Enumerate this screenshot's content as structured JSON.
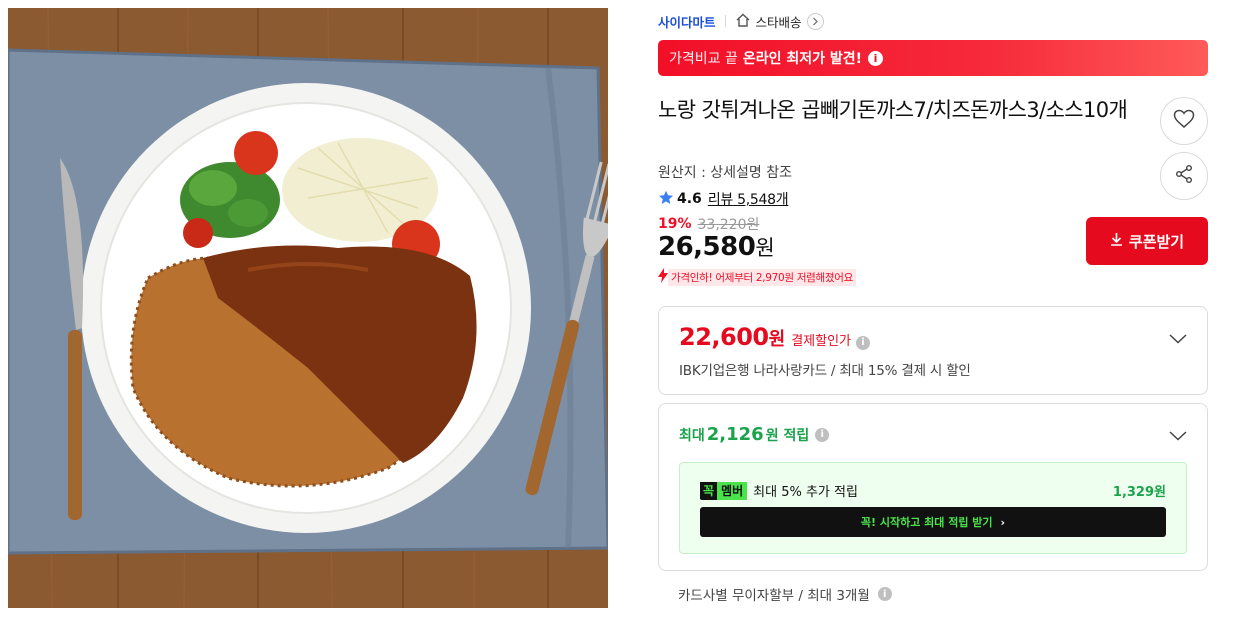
{
  "store": {
    "name": "사이다마트",
    "shipping_label": "스타배송"
  },
  "banner": {
    "prefix": "가격비교 끝",
    "highlight": "온라인 최저가 발견!",
    "info_icon": "info-icon"
  },
  "product": {
    "title": "노랑 갓튀겨나온 곱빼기돈까스7/치즈돈까스3/소스10개",
    "origin": "원산지 : 상세설명 참조",
    "rating": "4.6",
    "review_text": "리뷰 5,548개",
    "discount_pct": "19%",
    "original_price": "33,220원",
    "price_number": "26,580",
    "price_unit": "원",
    "price_drop_notice": "가격인하! 어제부터 2,970원 저렴해졌어요"
  },
  "actions": {
    "coupon_label": "쿠폰받기"
  },
  "payment_discount": {
    "price_number": "22,600",
    "price_unit": "원",
    "label": "결제할인가",
    "card_info": "IBK기업은행 나라사랑카드 / 최대 15% 결제 시 할인"
  },
  "points": {
    "prefix": "최대",
    "amount": "2,126",
    "suffix": "원 적립",
    "member": {
      "badge_left": "꼭",
      "badge_right": "멤버",
      "desc": "최대 5% 추가 적립",
      "points": "1,329원",
      "cta": "꼭! 시작하고 최대 적립 받기"
    }
  },
  "installment": "카드사별 무이자할부 / 최대 3개월",
  "colors": {
    "accent_red": "#e60a1e",
    "store_blue": "#1a4fd9",
    "point_green": "#1aa34a",
    "member_green": "#4ae44a"
  }
}
